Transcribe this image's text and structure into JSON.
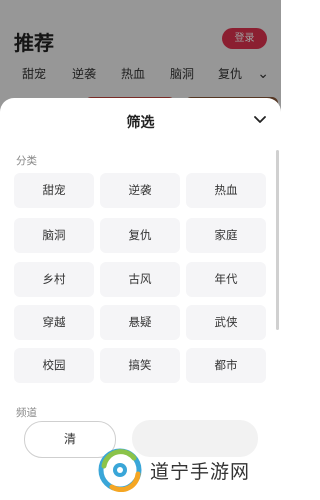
{
  "background": {
    "title": "推荐",
    "login_label": "登录",
    "categories": [
      "甜宠",
      "逆袭",
      "热血",
      "脑洞",
      "复仇"
    ]
  },
  "sheet": {
    "title": "筛选",
    "section_category": "分类",
    "section_channel": "频道",
    "categories": [
      "甜宠",
      "逆袭",
      "热血",
      "脑洞",
      "复仇",
      "家庭",
      "乡村",
      "古风",
      "年代",
      "穿越",
      "悬疑",
      "武侠",
      "校园",
      "搞笑",
      "都市"
    ],
    "clear_label": "清"
  },
  "watermark": {
    "text": "道宁手游网"
  },
  "colors": {
    "accent": "#e0334f",
    "chip_bg": "#f5f5f7"
  }
}
